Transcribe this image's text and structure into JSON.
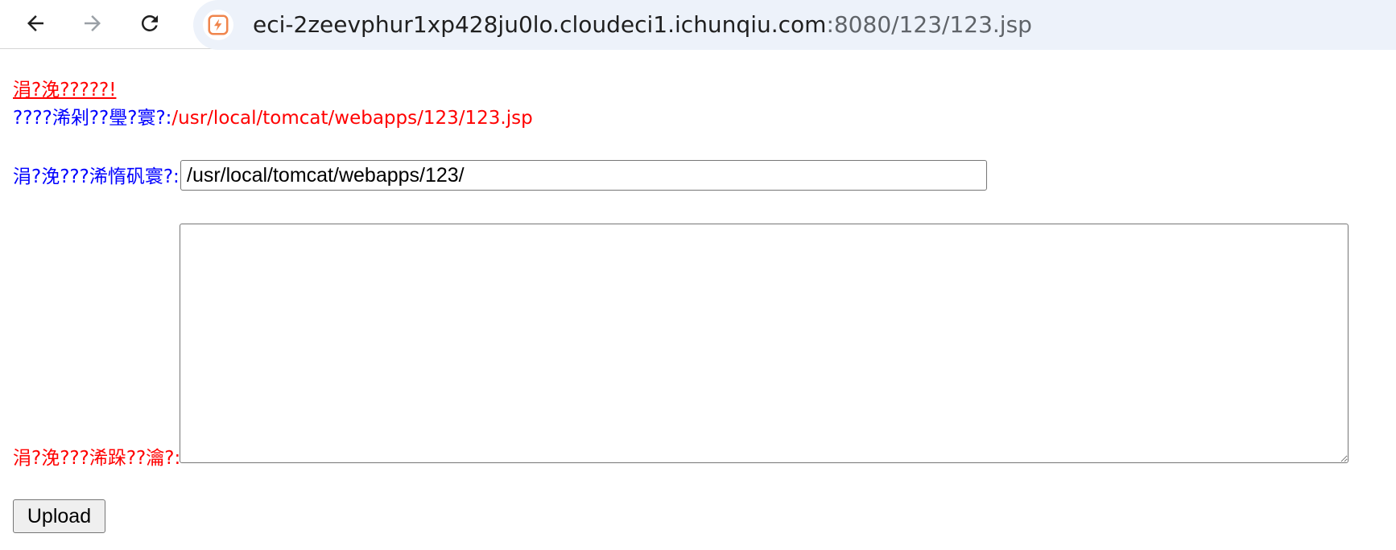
{
  "browser": {
    "url_host": "eci-2zeevphur1xp428ju0lo.cloudeci1.ichunqiu.com",
    "url_path": ":8080/123/123.jsp",
    "back_icon": "arrow-left-icon",
    "forward_icon": "arrow-right-icon",
    "reload_icon": "reload-icon",
    "site_icon": "site-bolt-icon"
  },
  "page": {
    "message_link": "涓?浼?????!",
    "current_file_label": "????浠剁??璺?寰?:",
    "current_file_path": "/usr/local/tomcat/webapps/123/123.jsp",
    "dir_label": "涓?浼???浠惰矾寰?:",
    "dir_value": "/usr/local/tomcat/webapps/123/",
    "content_label": "涓?浼???浠跺??瀹?:",
    "content_value": "",
    "upload_label": "Upload"
  },
  "colors": {
    "label_blue": "#0000ff",
    "label_red": "#ff0000",
    "omnibox_bg": "#edf2fa",
    "site_icon_accent": "#f0854c"
  }
}
